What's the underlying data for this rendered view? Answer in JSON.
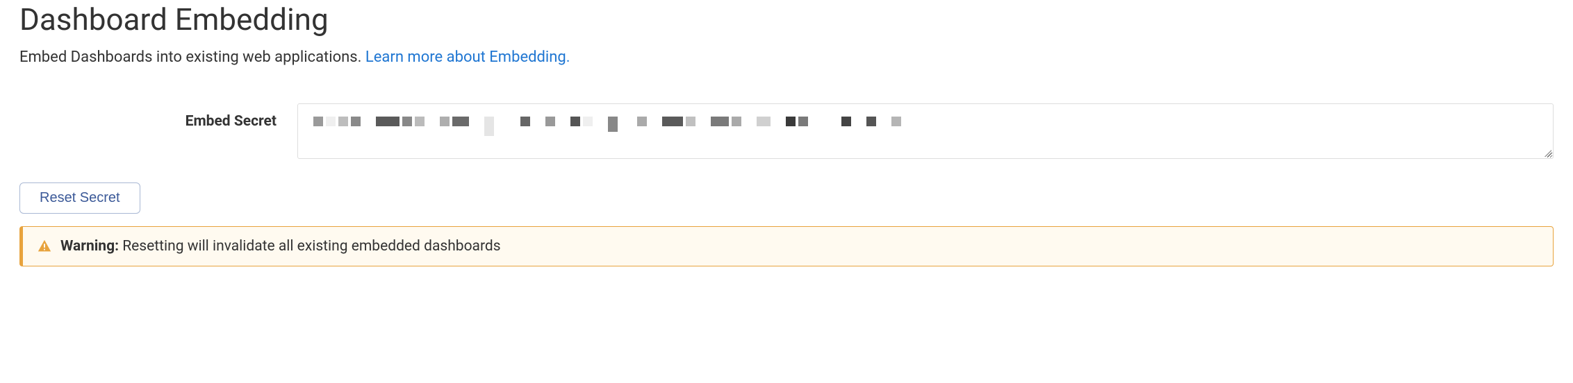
{
  "page": {
    "title": "Dashboard Embedding",
    "subtitle_text": "Embed Dashboards into existing web applications. ",
    "subtitle_link": "Learn more about Embedding."
  },
  "form": {
    "label": "Embed Secret",
    "reset_button": "Reset Secret"
  },
  "warning": {
    "label": "Warning:",
    "text": " Resetting will invalidate all existing embedded dashboards"
  }
}
